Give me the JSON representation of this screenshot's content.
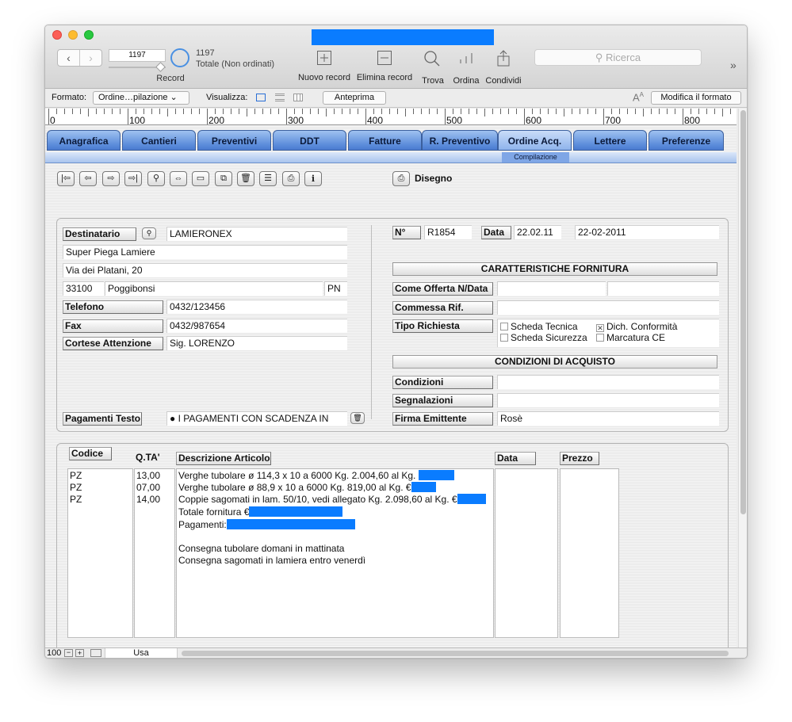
{
  "toolbar": {
    "record_value": "1197",
    "record_label": "Record",
    "total_count": "1197",
    "total_label": "Totale (Non ordinati)",
    "new_record": "Nuovo record",
    "delete_record": "Elimina record",
    "find": "Trova",
    "sort": "Ordina",
    "share": "Condividi",
    "search_placeholder": "Ricerca"
  },
  "formatbar": {
    "format_label": "Formato:",
    "format_value": "Ordine…pilazione",
    "view_label": "Visualizza:",
    "preview": "Anteprima",
    "modify_format": "Modifica il formato"
  },
  "ruler": [
    "0",
    "100",
    "200",
    "300",
    "400",
    "500",
    "600",
    "700",
    "800"
  ],
  "tabs": [
    "Anagrafica",
    "Cantieri",
    "Preventivi",
    "DDT",
    "Fatture",
    "R. Preventivo",
    "Ordine Acq.",
    "Lettere",
    "Preferenze"
  ],
  "subtab": "Compilazione",
  "disegno": "Disegno",
  "recipient": {
    "destinatario_label": "Destinatario",
    "destinatario": "LAMIERONEX",
    "ragione_sociale": "Super Piega Lamiere",
    "indirizzo": "Via dei Platani, 20",
    "cap": "33100",
    "citta": "Poggibonsi",
    "provincia": "PN",
    "telefono_label": "Telefono",
    "telefono": "0432/123456",
    "fax_label": "Fax",
    "fax": "0432/987654",
    "attenzione_label": "Cortese Attenzione",
    "attenzione": "Sig. LORENZO",
    "pagamenti_label": "Pagamenti Testo",
    "pagamenti": "● I PAGAMENTI CON SCADENZA IN"
  },
  "order": {
    "numero_label": "N°",
    "numero": "R1854",
    "data_label": "Data",
    "data_short": "22.02.11",
    "data_long": "22-02-2011",
    "caratteristiche_title": "CARATTERISTICHE FORNITURA",
    "offerta_label": "Come Offerta N/Data",
    "commessa_label": "Commessa Rif.",
    "tipo_label": "Tipo Richiesta",
    "checks": [
      {
        "label": "Scheda Tecnica",
        "checked": false
      },
      {
        "label": "Dich. Conformità",
        "checked": true
      },
      {
        "label": "Scheda Sicurezza",
        "checked": false
      },
      {
        "label": "Marcatura CE",
        "checked": false
      }
    ],
    "condizioni_title": "CONDIZIONI DI ACQUISTO",
    "condizioni_label": "Condizioni",
    "segnalazioni_label": "Segnalazioni",
    "firma_label": "Firma Emittente",
    "firma": "Rosè"
  },
  "items": {
    "headers": {
      "codice": "Codice",
      "qta": "Q.TA'",
      "descrizione": "Descrizione Articolo",
      "data": "Data",
      "prezzo": "Prezzo"
    },
    "codici": [
      "PZ",
      "PZ",
      "PZ"
    ],
    "quantita": [
      "13,00",
      "07,00",
      "14,00"
    ],
    "righe": [
      "Verghe tubolare ø 114,3 x 10 a 6000  Kg. 2.004,60  al Kg.",
      "Verghe tubolare ø 88,9 x 10 a 6000  Kg. 819,00  al Kg. €",
      "Coppie sagomati in lam. 50/10, vedi allegato Kg. 2.098,60  al Kg. €",
      "Totale fornitura €",
      "Pagamenti:",
      "",
      "Consegna tubolare domani in mattinata",
      "Consegna sagomati in lamiera entro venerdì"
    ]
  },
  "status": {
    "zoom": "100",
    "mode": "Usa"
  },
  "colors": {
    "redaction": "#0a7cff",
    "tab": "#5f8fdc"
  }
}
